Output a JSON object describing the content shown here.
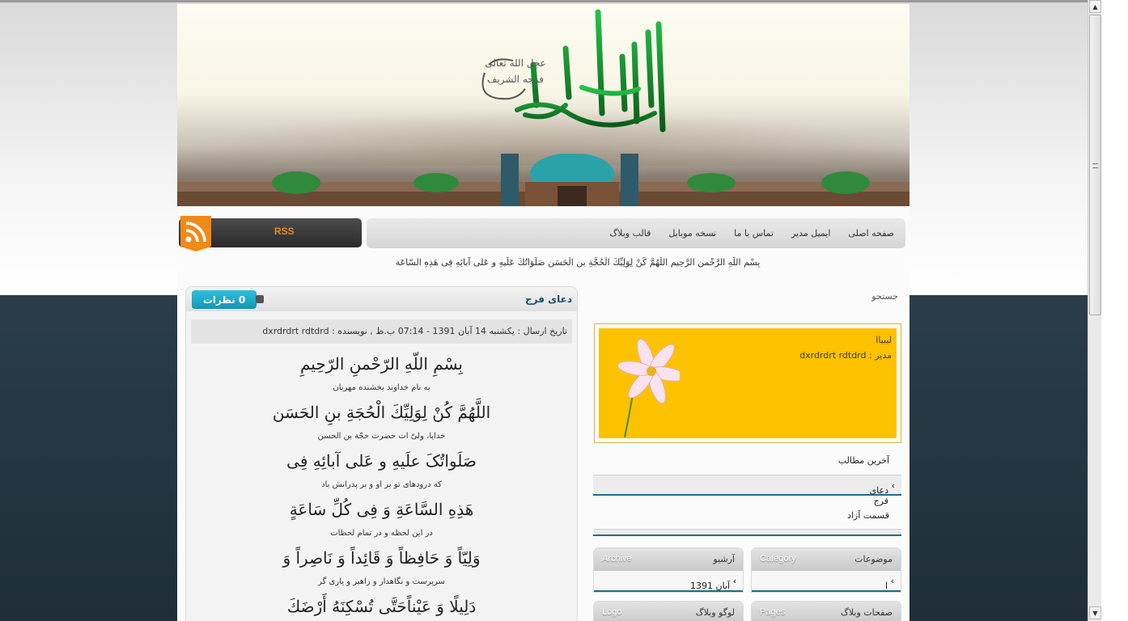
{
  "nav": {
    "items": [
      "صفحه اصلی",
      "ایمیل مدیر",
      "تماس با ما",
      "نسخه موبایل",
      "قالب وبلاگ"
    ],
    "rss_label": "RSS"
  },
  "ticker": "بِسْمِ اللَّهِ الرَّحْمنِ الرَّحِيمِ اللَّهُمَّ كُنْ لِوَلِيِّكَ الْحُجَّةِ بنِ الْحَسَنِ صَلَوَاتُكَ عَلَيهِ و عَلى آبائِهِ فِى هَذِهِ السّاعَة",
  "post": {
    "title": "دعای فرج",
    "comments_count": "0",
    "comments_label": "نظرات",
    "meta": "تاریخ ارسال : یکشنبه 14 آبان 1391 - 07:14 ب.ظ  ,  نویسنده : dxrdrdrt rdtdrd",
    "lines": [
      {
        "arabic": "بِسْمِ اللّهِ الرّحْمنِ الرّحِيمِ",
        "persian": "به نام خداوند بخشنده مهربان"
      },
      {
        "arabic": "اللَّهُمَّ كُنْ لِوَلِيِّكَ الْحُجَةِ بنِ الحَسَن",
        "persian": "خدایا، ولیّ ات حضرت حجّة بن الحسن"
      },
      {
        "arabic": "صَلَواتُکَ علَیهِ و عَلی آبائِهِ فِی",
        "persian": "که درودهای تو بر او و بر پدرانش باد"
      },
      {
        "arabic": "هَذِهِ السَّاعَةِ وَ فِی کُلِّ سَاعَةٍ",
        "persian": "در این لحظه و در تمام لحظات"
      },
      {
        "arabic": "وَلِيّاً وَ حَافِظاً وَ قَائِداً وَ نَاصِراً وَ",
        "persian": "سرپرست و نگاهدار و راهبر و یاری گر"
      },
      {
        "arabic": "دَلِيلًا وَ عَيْناًحَتَّى تُسْكِنَهُ أَرْضَكَ",
        "persian": ""
      }
    ]
  },
  "sidebar": {
    "search_label": "جستجو",
    "profile_name": "لیبیاا",
    "profile_admin": "مدیر : dxrdrdrt rdtdrd",
    "latest_title": "آخرین مطالب",
    "latest_items": [
      "دعای فرج"
    ],
    "free_section_title": "قسمت آزاد",
    "boxes": [
      {
        "fa": "موضوعات",
        "en": "Category",
        "item": "ا"
      },
      {
        "fa": "آرشیو",
        "en": "Archive",
        "item": "آبان 1391"
      },
      {
        "fa": "صفحات وبلاگ",
        "en": "Pages",
        "item": ""
      },
      {
        "fa": "لوگو وبلاگ",
        "en": "Logo",
        "item": ""
      }
    ]
  },
  "colors": {
    "accent_teal": "#1a6e8a",
    "profile_bg": "#fcc200",
    "comment_btn": "#1ea8c8",
    "rss_orange": "#e58a20"
  }
}
